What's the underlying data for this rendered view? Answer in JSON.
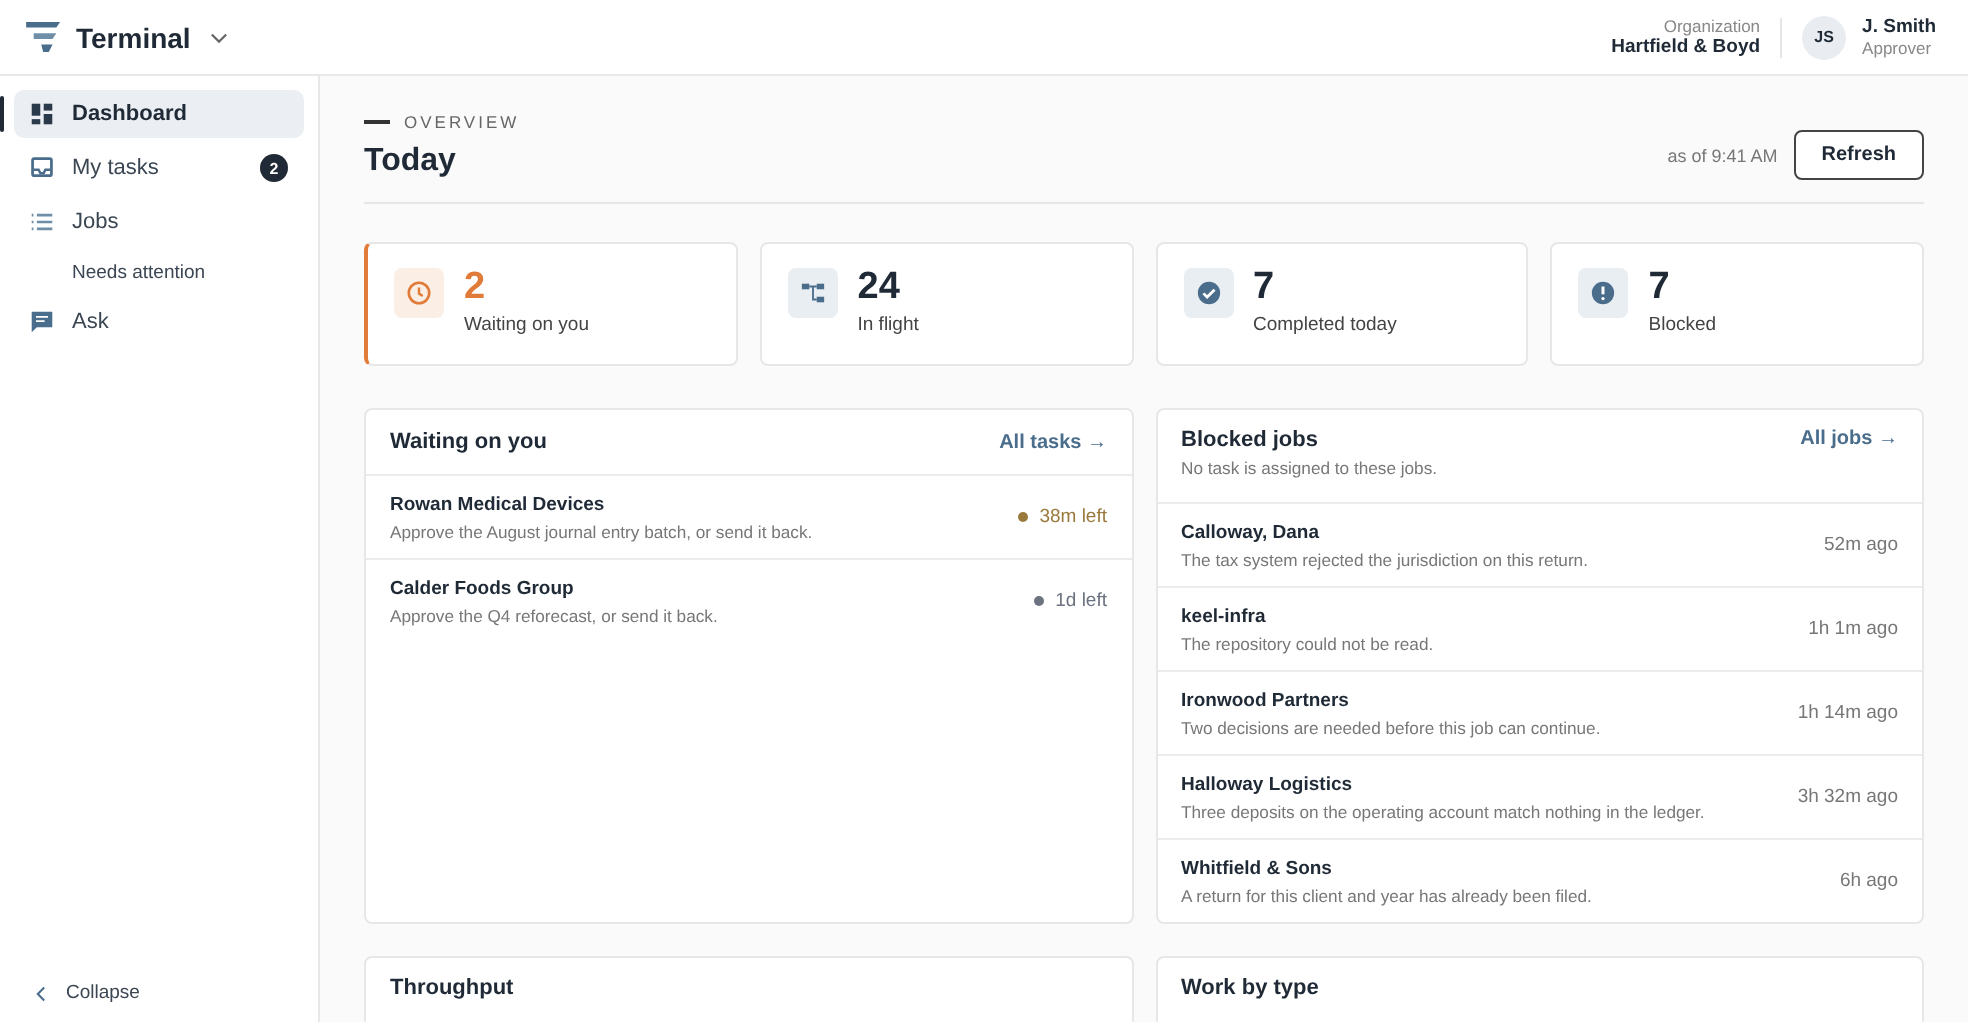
{
  "app": {
    "title": "Terminal"
  },
  "header": {
    "org_label": "Organization",
    "org_name": "Hartfield & Boyd",
    "user_initials": "JS",
    "user_name": "J. Smith",
    "user_role": "Approver"
  },
  "sidebar": {
    "items": [
      {
        "label": "Dashboard",
        "kind": "grid",
        "selected": true
      },
      {
        "label": "My tasks",
        "kind": "inbox",
        "selected": false,
        "badge": "2"
      },
      {
        "label": "Jobs",
        "kind": "list",
        "selected": false,
        "children": [
          {
            "label": "Needs attention",
            "selected": false
          }
        ]
      },
      {
        "label": "Ask",
        "kind": "chat",
        "selected": false
      }
    ],
    "collapse": "Collapse"
  },
  "overview": {
    "eyebrow": "OVERVIEW",
    "title": "Today",
    "as_of": "as of 9:41 AM",
    "refresh": "Refresh"
  },
  "stats": [
    {
      "kind": "clock",
      "value": "2",
      "label": "Waiting on you",
      "highlighted": true
    },
    {
      "kind": "flow",
      "value": "24",
      "label": "In flight",
      "highlighted": false
    },
    {
      "kind": "check",
      "value": "7",
      "label": "Completed today",
      "highlighted": false
    },
    {
      "kind": "alert",
      "value": "7",
      "label": "Blocked",
      "highlighted": false
    }
  ],
  "waiting": {
    "title": "Waiting on you",
    "link": "All tasks →",
    "rows": [
      {
        "name": "Rowan Medical Devices",
        "detail": "Approve the August journal entry batch, or send it back.",
        "due": "38m left",
        "color": "#9a7a3c"
      },
      {
        "name": "Calder Foods Group",
        "detail": "Approve the Q4 reforecast, or send it back.",
        "due": "1d left",
        "color": "#6b7280"
      }
    ]
  },
  "blocked": {
    "title": "Blocked jobs",
    "subtitle": "No task is assigned to these jobs.",
    "link": "All jobs →",
    "rows": [
      {
        "name": "Calloway, Dana",
        "detail": "The tax system rejected the jurisdiction on this return.",
        "age": "52m ago"
      },
      {
        "name": "keel-infra",
        "detail": "The repository could not be read.",
        "age": "1h 1m ago"
      },
      {
        "name": "Ironwood Partners",
        "detail": "Two decisions are needed before this job can continue.",
        "age": "1h 14m ago"
      },
      {
        "name": "Halloway Logistics",
        "detail": "Three deposits on the operating account match nothing in the ledger.",
        "age": "3h 32m ago"
      },
      {
        "name": "Whitfield & Sons",
        "detail": "A return for this client and year has already been filed.",
        "age": "6h ago"
      }
    ]
  },
  "lower_cards": [
    {
      "title": "Throughput"
    },
    {
      "title": "Work by type"
    }
  ]
}
